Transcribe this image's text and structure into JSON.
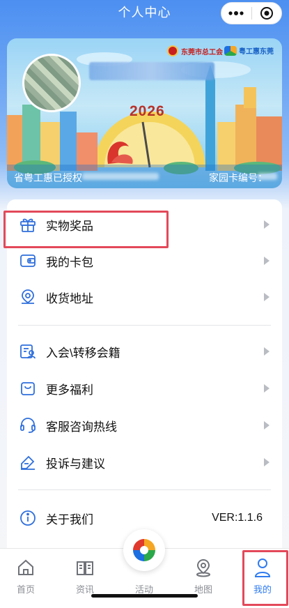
{
  "nav": {
    "title": "个人中心"
  },
  "card": {
    "logo_union": "东莞市总工会",
    "logo_app": "粤工惠东莞",
    "year_label": "2026",
    "footer_left": "省粤工惠已授权",
    "footer_right": "家园卡编号："
  },
  "menu": {
    "group1": [
      {
        "label": "实物奖品",
        "icon": "gift-icon"
      },
      {
        "label": "我的卡包",
        "icon": "wallet-icon"
      },
      {
        "label": "收货地址",
        "icon": "location-pin-icon"
      }
    ],
    "group2": [
      {
        "label": "入会\\转移会籍",
        "icon": "member-card-icon"
      },
      {
        "label": "更多福利",
        "icon": "welfare-bag-icon"
      },
      {
        "label": "客服咨询热线",
        "icon": "headset-icon"
      },
      {
        "label": "投诉与建议",
        "icon": "feedback-icon"
      }
    ],
    "about": {
      "label": "关于我们",
      "icon": "info-icon",
      "version": "VER:1.1.6"
    }
  },
  "tabbar": {
    "items": [
      {
        "label": "首页",
        "icon": "home-icon"
      },
      {
        "label": "资讯",
        "icon": "book-icon"
      },
      {
        "label": "活动",
        "icon": "activity-logo-icon"
      },
      {
        "label": "地图",
        "icon": "map-pin-icon"
      },
      {
        "label": "我的",
        "icon": "profile-icon",
        "active": true
      }
    ]
  },
  "colors": {
    "accent": "#2f7bf0",
    "highlight": "#e3495a",
    "icon_blue": "#2f6fdc"
  }
}
